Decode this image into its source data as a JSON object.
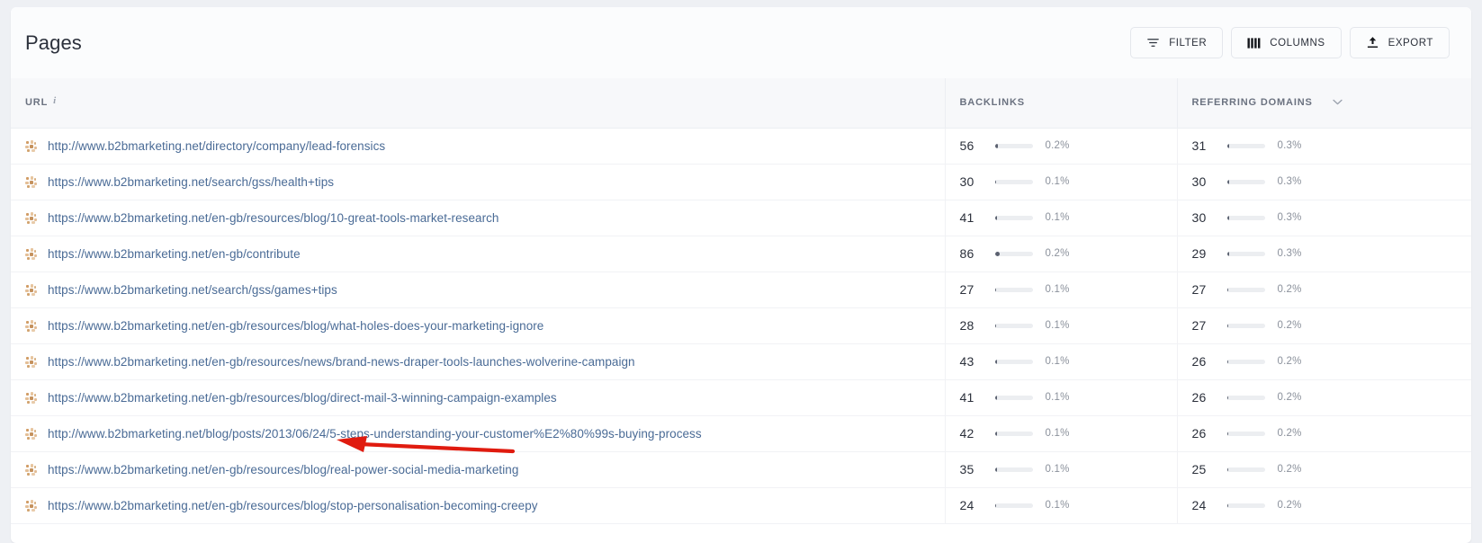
{
  "header": {
    "title": "Pages",
    "buttons": [
      {
        "label": "FILTER",
        "icon": "filter-icon"
      },
      {
        "label": "COLUMNS",
        "icon": "columns-icon"
      },
      {
        "label": "EXPORT",
        "icon": "export-icon"
      }
    ]
  },
  "table": {
    "columns": [
      {
        "key": "url",
        "label": "URL",
        "info": "i"
      },
      {
        "key": "backlinks",
        "label": "BACKLINKS"
      },
      {
        "key": "referring_domains",
        "label": "REFERRING DOMAINS",
        "sorted": "desc",
        "caret": "⌄"
      }
    ],
    "rows": [
      {
        "icon": "favicon",
        "url": "http://www.b2bmarketing.net/directory/company/lead-forensics",
        "backlinks": "56",
        "backlinks_pct": "0.2%",
        "backlinks_bar": 8,
        "domains": "31",
        "domains_pct": "0.3%",
        "domains_bar": 5
      },
      {
        "icon": "favicon",
        "url": "https://www.b2bmarketing.net/search/gss/health+tips",
        "backlinks": "30",
        "backlinks_pct": "0.1%",
        "backlinks_bar": 4,
        "domains": "30",
        "domains_pct": "0.3%",
        "domains_bar": 5
      },
      {
        "icon": "favicon",
        "url": "https://www.b2bmarketing.net/en-gb/resources/blog/10-great-tools-market-research",
        "backlinks": "41",
        "backlinks_pct": "0.1%",
        "backlinks_bar": 6,
        "domains": "30",
        "domains_pct": "0.3%",
        "domains_bar": 5
      },
      {
        "icon": "favicon",
        "url": "https://www.b2bmarketing.net/en-gb/contribute",
        "backlinks": "86",
        "backlinks_pct": "0.2%",
        "backlinks_bar": 12,
        "domains": "29",
        "domains_pct": "0.3%",
        "domains_bar": 5
      },
      {
        "icon": "favicon",
        "url": "https://www.b2bmarketing.net/search/gss/games+tips",
        "backlinks": "27",
        "backlinks_pct": "0.1%",
        "backlinks_bar": 4,
        "domains": "27",
        "domains_pct": "0.2%",
        "domains_bar": 4
      },
      {
        "icon": "favicon",
        "url": "https://www.b2bmarketing.net/en-gb/resources/blog/what-holes-does-your-marketing-ignore",
        "backlinks": "28",
        "backlinks_pct": "0.1%",
        "backlinks_bar": 4,
        "domains": "27",
        "domains_pct": "0.2%",
        "domains_bar": 4
      },
      {
        "icon": "favicon",
        "url": "https://www.b2bmarketing.net/en-gb/resources/news/brand-news-draper-tools-launches-wolverine-campaign",
        "backlinks": "43",
        "backlinks_pct": "0.1%",
        "backlinks_bar": 6,
        "domains": "26",
        "domains_pct": "0.2%",
        "domains_bar": 3
      },
      {
        "icon": "favicon",
        "url": "https://www.b2bmarketing.net/en-gb/resources/blog/direct-mail-3-winning-campaign-examples",
        "backlinks": "41",
        "backlinks_pct": "0.1%",
        "backlinks_bar": 6,
        "domains": "26",
        "domains_pct": "0.2%",
        "domains_bar": 3
      },
      {
        "icon": "favicon",
        "url": "http://www.b2bmarketing.net/blog/posts/2013/06/24/5-steps-understanding-your-customer%E2%80%99s-buying-process",
        "backlinks": "42",
        "backlinks_pct": "0.1%",
        "backlinks_bar": 6,
        "domains": "26",
        "domains_pct": "0.2%",
        "domains_bar": 3
      },
      {
        "icon": "favicon",
        "url": "https://www.b2bmarketing.net/en-gb/resources/blog/real-power-social-media-marketing",
        "backlinks": "35",
        "backlinks_pct": "0.1%",
        "backlinks_bar": 5,
        "domains": "25",
        "domains_pct": "0.2%",
        "domains_bar": 3
      },
      {
        "icon": "favicon",
        "url": "https://www.b2bmarketing.net/en-gb/resources/blog/stop-personalisation-becoming-creepy",
        "backlinks": "24",
        "backlinks_pct": "0.1%",
        "backlinks_bar": 3,
        "domains": "24",
        "domains_pct": "0.2%",
        "domains_bar": 3
      }
    ]
  },
  "annotation": {
    "type": "arrow",
    "color": "#e01b0f",
    "points_at_row": 8
  },
  "colors": {
    "page_background": "#eef0f4",
    "card_background": "#ffffff",
    "header_background": "#fbfcfd",
    "link": "#4a6b96",
    "text": "#2b303b",
    "muted": "#8b919c",
    "bar_track": "#eceef1",
    "bar_fill": "#5b6170",
    "annotation": "#e01b0f"
  }
}
